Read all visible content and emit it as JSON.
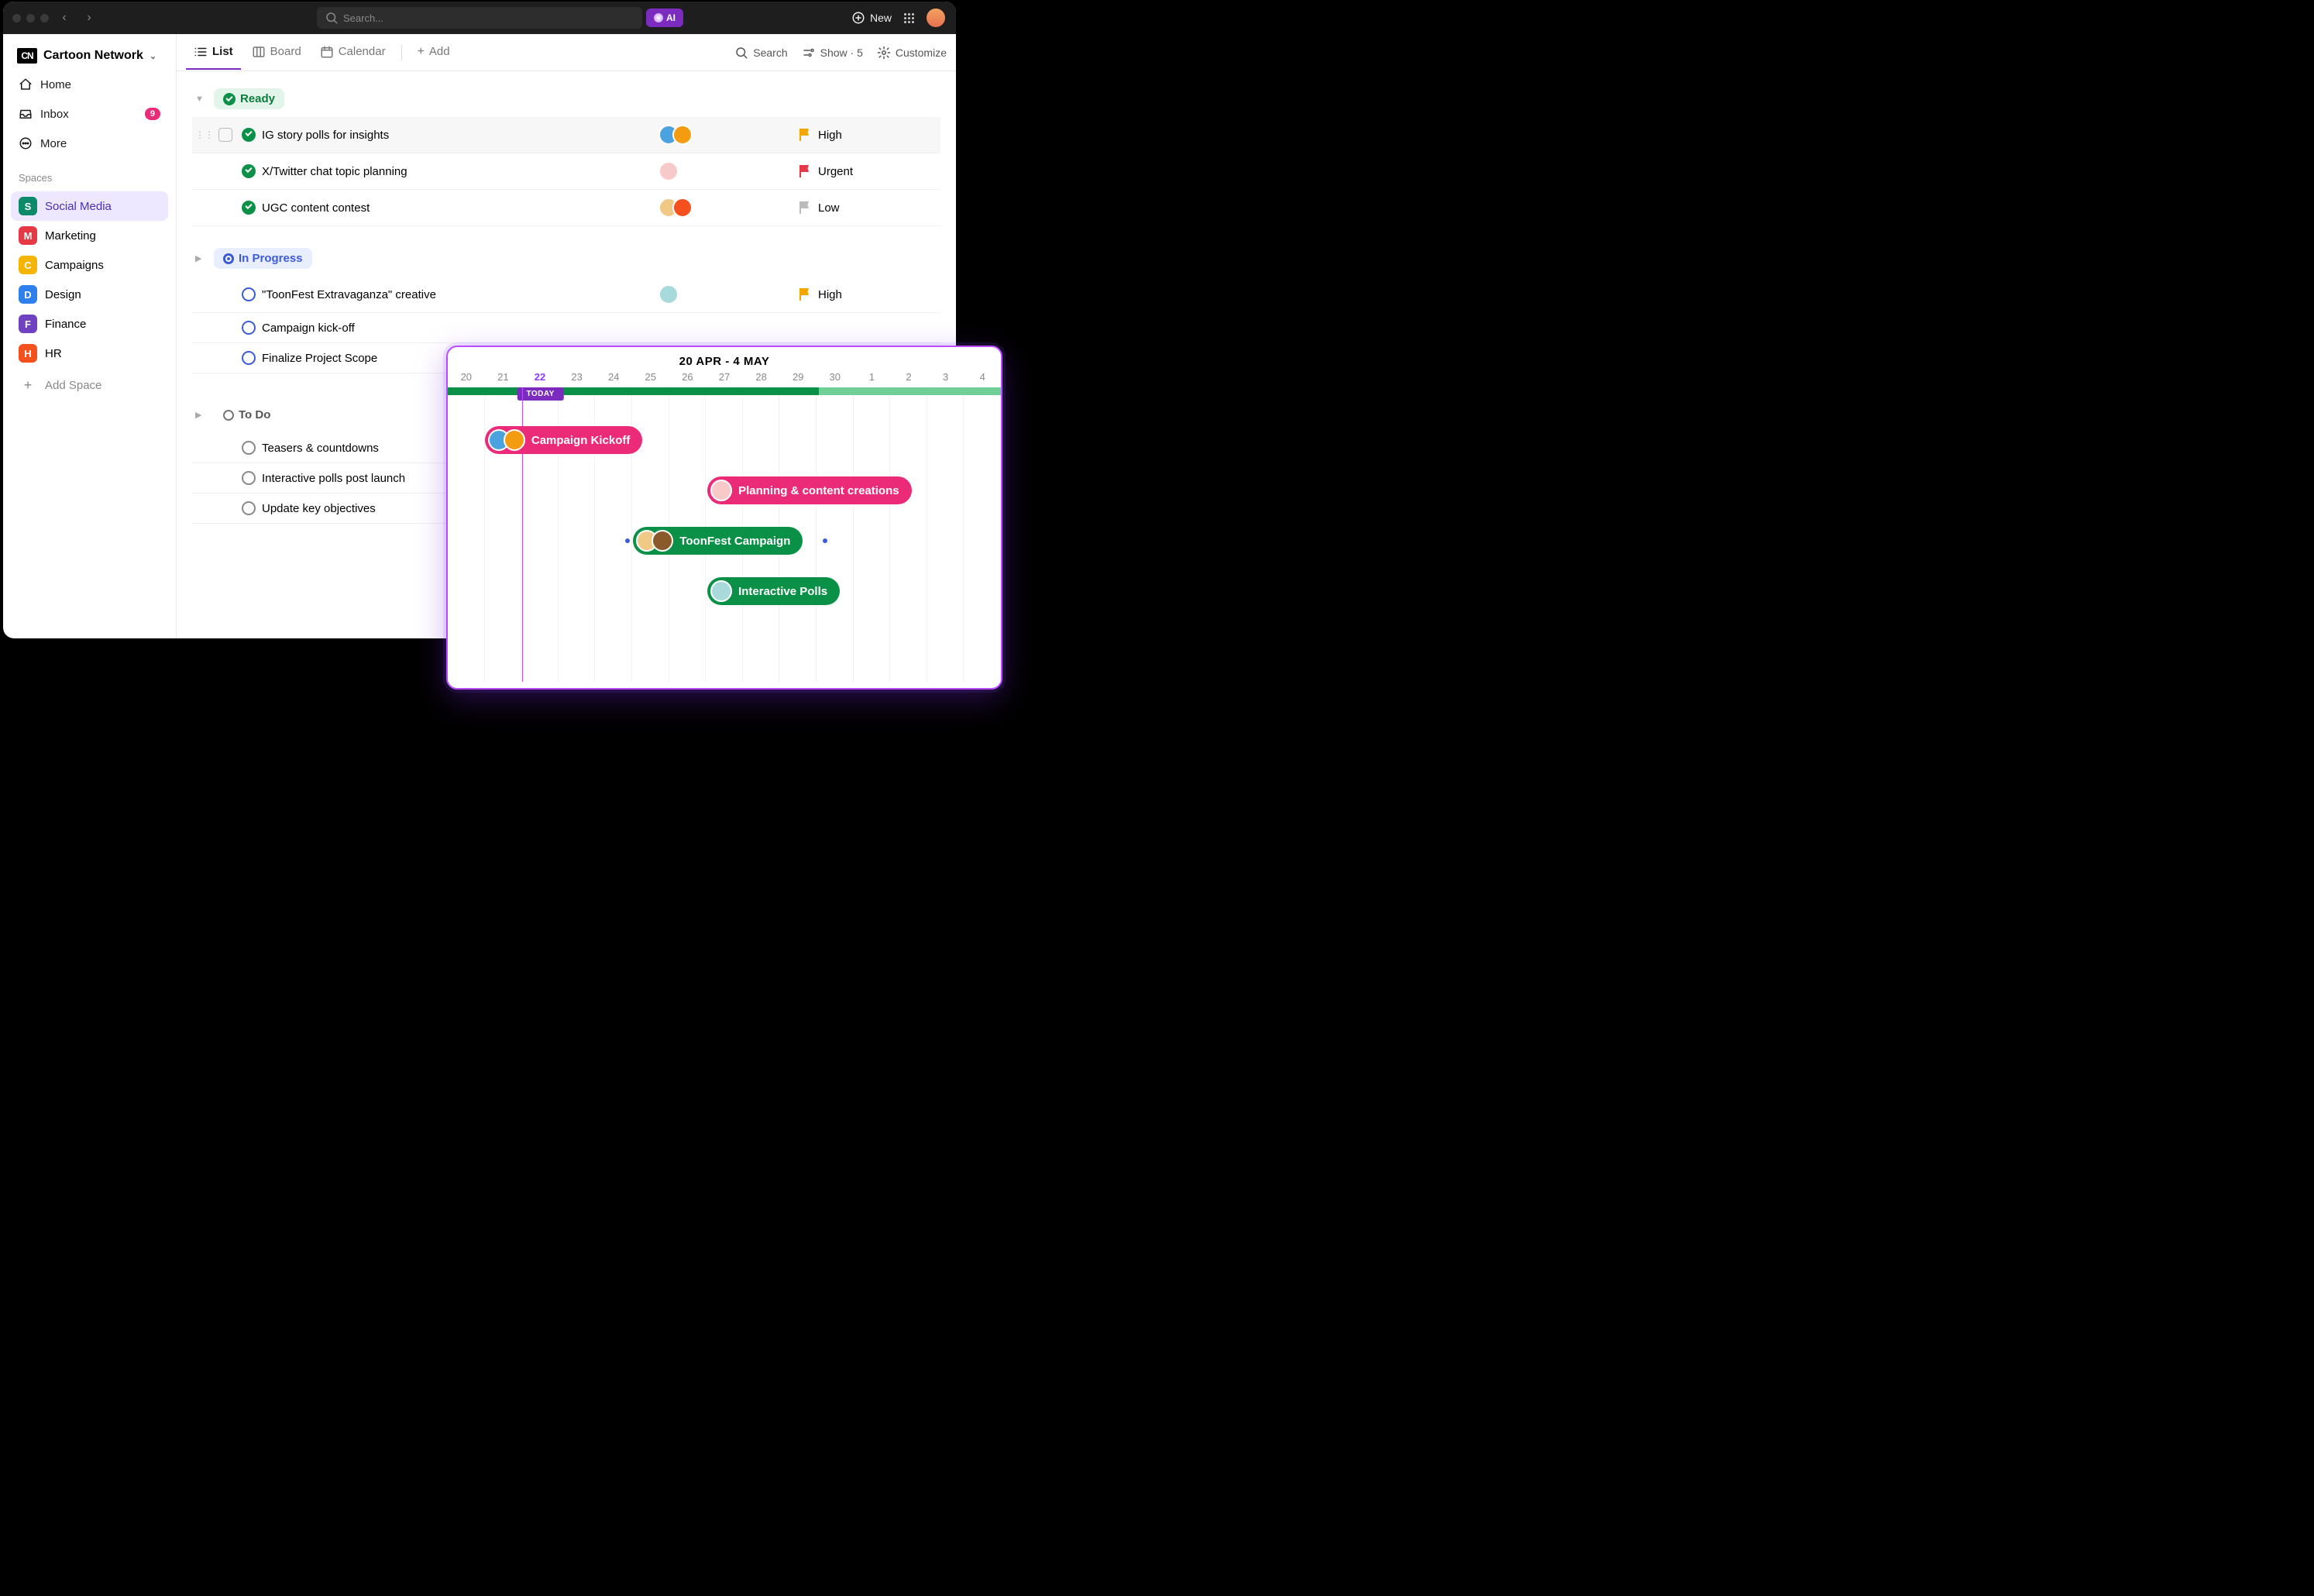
{
  "topbar": {
    "search_placeholder": "Search...",
    "ai_label": "AI",
    "new_label": "New"
  },
  "workspace": {
    "name": "Cartoon Network"
  },
  "sidebar_nav": {
    "home": "Home",
    "inbox": "Inbox",
    "inbox_badge": "9",
    "more": "More"
  },
  "sidebar": {
    "spaces_label": "Spaces",
    "add_space": "Add Space",
    "spaces": [
      {
        "letter": "S",
        "label": "Social Media",
        "bg": "#0d8a6a",
        "active": true
      },
      {
        "letter": "M",
        "label": "Marketing",
        "bg": "#e63946"
      },
      {
        "letter": "C",
        "label": "Campaigns",
        "bg": "#f4b400"
      },
      {
        "letter": "D",
        "label": "Design",
        "bg": "#2f80ed"
      },
      {
        "letter": "F",
        "label": "Finance",
        "bg": "#6f42c1"
      },
      {
        "letter": "H",
        "label": "HR",
        "bg": "#f4511e"
      }
    ]
  },
  "views": {
    "list": "List",
    "board": "Board",
    "calendar": "Calendar",
    "add": "Add",
    "search": "Search",
    "show": "Show · 5",
    "customize": "Customize"
  },
  "groups": {
    "ready": "Ready",
    "in_progress": "In Progress",
    "todo": "To Do"
  },
  "tasks": {
    "ready": [
      {
        "name": "IG story polls for insights",
        "priority": "High",
        "prio_color": "#f4a500",
        "avatars": [
          "#4aa3df",
          "#f39c12"
        ],
        "hovered": true
      },
      {
        "name": "X/Twitter chat topic planning",
        "priority": "Urgent",
        "prio_color": "#e63946",
        "avatars": [
          "#f7cac9"
        ]
      },
      {
        "name": "UGC content contest",
        "priority": "Low",
        "prio_color": "#bbb",
        "avatars": [
          "#f0c987",
          "#f4511e"
        ]
      }
    ],
    "in_progress": [
      {
        "name": "\"ToonFest Extravaganza\" creative",
        "priority": "High",
        "prio_color": "#f4a500",
        "avatars": [
          "#a8dadc"
        ]
      },
      {
        "name": "Campaign kick-off"
      },
      {
        "name": "Finalize Project Scope"
      }
    ],
    "todo": [
      {
        "name": "Teasers & countdowns"
      },
      {
        "name": "Interactive polls post launch"
      },
      {
        "name": "Update key objectives"
      }
    ]
  },
  "gantt": {
    "range_label": "20 APR - 4 MAY",
    "today_label": "TODAY",
    "days": [
      "20",
      "21",
      "22",
      "23",
      "24",
      "25",
      "26",
      "27",
      "28",
      "29",
      "30",
      "1",
      "2",
      "3",
      "4"
    ],
    "today_index": 2,
    "bars": [
      {
        "label": "Campaign Kickoff",
        "type": "pink",
        "start": 1,
        "span": 4,
        "row": 0,
        "avatars": [
          "#4aa3df",
          "#f39c12"
        ]
      },
      {
        "label": "Planning & content creations",
        "type": "pink",
        "start": 7,
        "span": 6,
        "row": 1,
        "avatars": [
          "#f7cac9"
        ]
      },
      {
        "label": "ToonFest Campaign",
        "type": "green",
        "start": 5,
        "span": 5,
        "row": 2,
        "avatars": [
          "#f0c987",
          "#8b5a2b"
        ]
      },
      {
        "label": "Interactive Polls",
        "type": "green",
        "start": 7,
        "span": 4,
        "row": 3,
        "avatars": [
          "#a8dadc"
        ]
      }
    ]
  }
}
